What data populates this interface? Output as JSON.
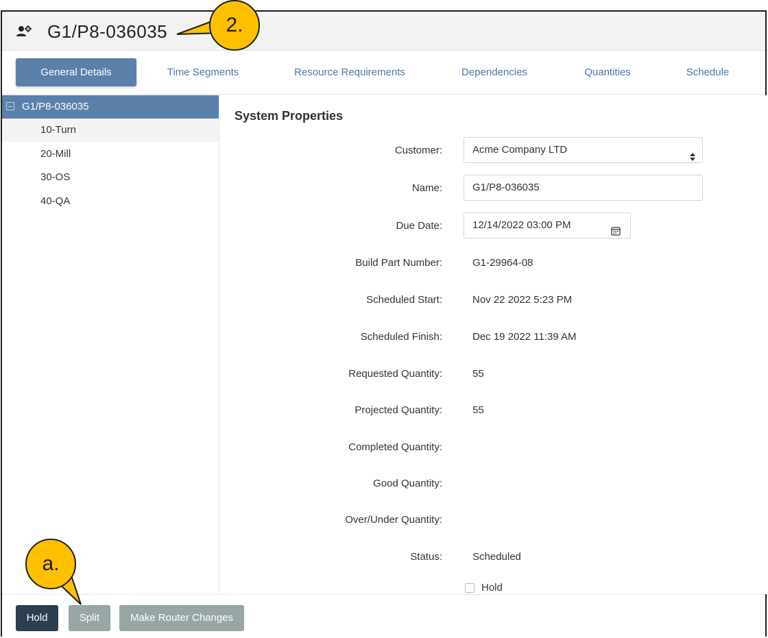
{
  "window": {
    "title": "G1/P8-036035",
    "title_icon": "user-gear-icon"
  },
  "tabs": [
    {
      "label": "General Details",
      "active": true
    },
    {
      "label": "Time Segments",
      "active": false
    },
    {
      "label": "Resource Requirements",
      "active": false
    },
    {
      "label": "Dependencies",
      "active": false
    },
    {
      "label": "Quantities",
      "active": false
    },
    {
      "label": "Schedule",
      "active": false
    }
  ],
  "tree": {
    "root": {
      "label": "G1/P8-036035",
      "expanded": true
    },
    "items": [
      {
        "label": "10-Turn"
      },
      {
        "label": "20-Mill"
      },
      {
        "label": "30-OS"
      },
      {
        "label": "40-QA"
      }
    ]
  },
  "form": {
    "section_title": "System Properties",
    "customer": {
      "label": "Customer:",
      "value": "Acme Company LTD"
    },
    "name": {
      "label": "Name:",
      "value": "G1/P8-036035"
    },
    "due_date": {
      "label": "Due Date:",
      "value": "12/14/2022 03:00 PM"
    },
    "build_part_number": {
      "label": "Build Part Number:",
      "value": "G1-29964-08"
    },
    "scheduled_start": {
      "label": "Scheduled Start:",
      "value": "Nov 22 2022 5:23 PM"
    },
    "scheduled_finish": {
      "label": "Scheduled Finish:",
      "value": "Dec 19 2022 11:39 AM"
    },
    "requested_quantity": {
      "label": "Requested Quantity:",
      "value": "55"
    },
    "projected_quantity": {
      "label": "Projected Quantity:",
      "value": "55"
    },
    "completed_quantity": {
      "label": "Completed Quantity:",
      "value": ""
    },
    "good_quantity": {
      "label": "Good Quantity:",
      "value": ""
    },
    "over_under_quantity": {
      "label": "Over/Under Quantity:",
      "value": ""
    },
    "status": {
      "label": "Status:",
      "value": "Scheduled"
    },
    "hold_checkbox": {
      "label": "Hold",
      "checked": false
    }
  },
  "footer": {
    "hold_button": "Hold",
    "split_button": "Split",
    "router_button": "Make Router Changes"
  },
  "callouts": {
    "title_callout": "2.",
    "split_callout": "a."
  },
  "colors": {
    "accent": "#5b80aa",
    "tab_link": "#4a76a8",
    "dark_button": "#2c3e50",
    "disabled_button": "#98a6a5",
    "callout": "#ffc000"
  }
}
